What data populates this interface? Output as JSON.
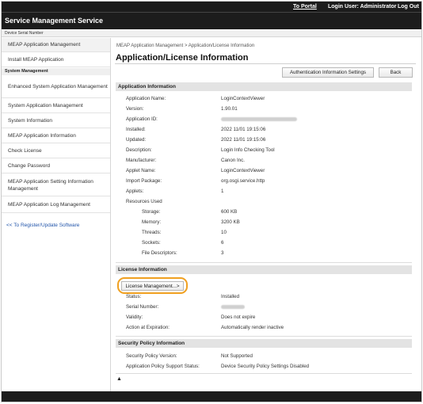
{
  "header": {
    "portal_link": "To Portal",
    "login_user": "Login User: Administrator",
    "logout": "Log Out",
    "title": "Service Management Service",
    "serial_label": "Device Serial Number"
  },
  "sidebar": {
    "items": [
      {
        "label": "MEAP Application Management"
      },
      {
        "label": "Install MEAP Application"
      }
    ],
    "section_title": "System Management",
    "system_items": [
      {
        "label": "Enhanced System Application Management"
      },
      {
        "label": "System Application Management"
      },
      {
        "label": "System Information"
      },
      {
        "label": "MEAP Application Information"
      },
      {
        "label": "Check License"
      },
      {
        "label": "Change Password"
      },
      {
        "label": "MEAP Application Setting Information Management"
      },
      {
        "label": "MEAP Application Log Management"
      }
    ],
    "register_link": "<< To Register/Update Software"
  },
  "main": {
    "breadcrumb": "MEAP Application Management > Application/License Information",
    "title": "Application/License Information",
    "auth_button": "Authentication Information Settings",
    "back_button": "Back",
    "app_section": "Application Information",
    "app_info": {
      "name_label": "Application Name:",
      "name_value": "LoginContextViewer",
      "version_label": "Version:",
      "version_value": "1.90.01",
      "id_label": "Application ID:",
      "installed_label": "Installed:",
      "installed_value": "2022 11/01 19:15:06",
      "updated_label": "Updated:",
      "updated_value": "2022 11/01 19:15:06",
      "description_label": "Description:",
      "description_value": "Login Info Checking Tool",
      "manufacturer_label": "Manufacturer:",
      "manufacturer_value": "Canon Inc.",
      "applet_label": "Applet Name:",
      "applet_value": "LoginContextViewer",
      "import_label": "Import Package:",
      "import_value": "org.osgi.service.http",
      "applets_label": "Applets:",
      "applets_value": "1",
      "resources_label": "Resources Used",
      "storage_label": "Storage:",
      "storage_value": "600 KB",
      "memory_label": "Memory:",
      "memory_value": "3200 KB",
      "threads_label": "Threads:",
      "threads_value": "10",
      "sockets_label": "Sockets:",
      "sockets_value": "6",
      "fd_label": "File Descriptors:",
      "fd_value": "3"
    },
    "license_section": "License Information",
    "license_button": "License Management...>",
    "license_info": {
      "status_label": "Status:",
      "status_value": "Installed",
      "serial_label": "Serial Number:",
      "validity_label": "Validity:",
      "validity_value": "Does not expire",
      "action_label": "Action at Expiration:",
      "action_value": "Automatically render inactive"
    },
    "security_section": "Security Policy Information",
    "security_info": {
      "version_label": "Security Policy Version:",
      "version_value": "Not Supported",
      "support_label": "Application Policy Support Status:",
      "support_value": "Device Security Policy Settings Disabled"
    },
    "to_top_icon": "to-top-arrow"
  }
}
